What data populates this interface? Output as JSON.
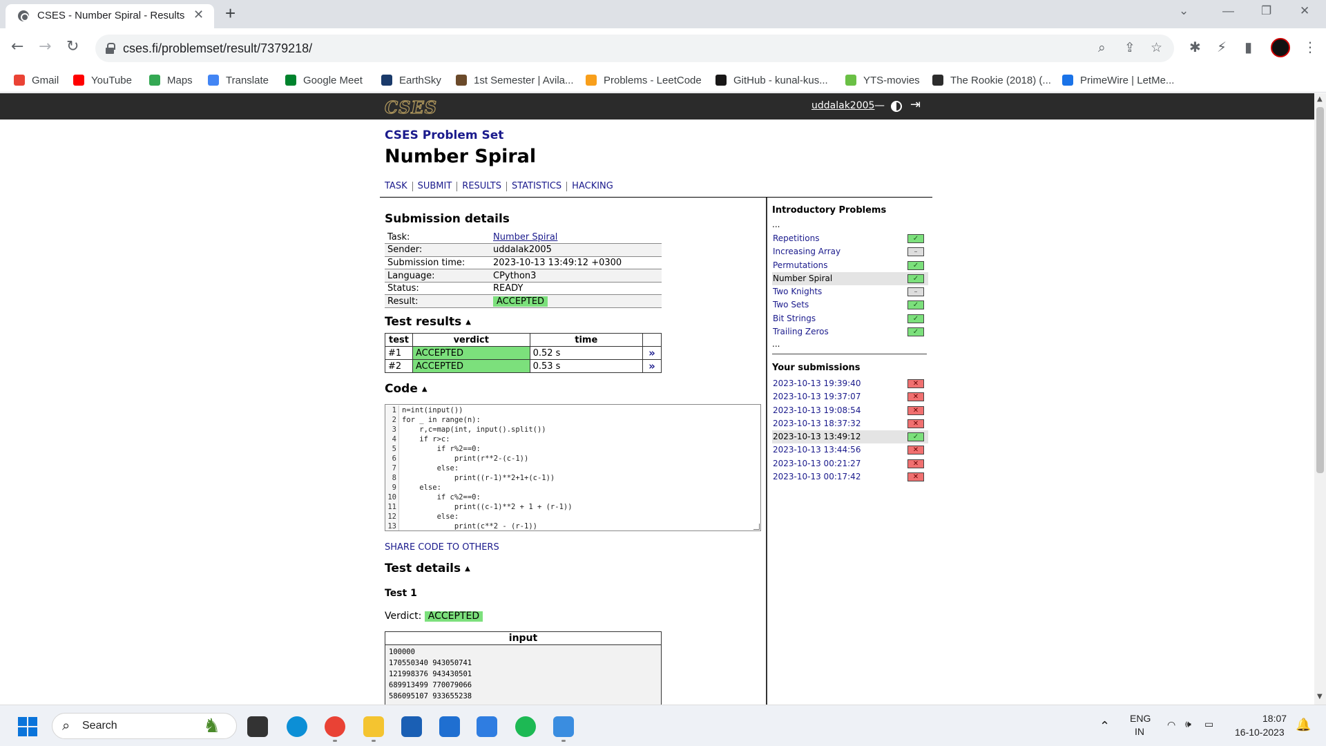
{
  "browser": {
    "tab_title": "CSES - Number Spiral - Results",
    "url": "cses.fi/problemset/result/7379218/",
    "bookmarks": [
      {
        "label": "Gmail",
        "color": "#ea4335"
      },
      {
        "label": "YouTube",
        "color": "#ff0000"
      },
      {
        "label": "Maps",
        "color": "#34a853"
      },
      {
        "label": "Translate",
        "color": "#4285f4"
      },
      {
        "label": "Google Meet",
        "color": "#00832d"
      },
      {
        "label": "EarthSky",
        "color": "#1a3a6a"
      },
      {
        "label": "1st Semester | Avila...",
        "color": "#6b4a2a"
      },
      {
        "label": "Problems - LeetCode",
        "color": "#f89f1b"
      },
      {
        "label": "GitHub - kunal-kus...",
        "color": "#181717"
      },
      {
        "label": "YTS-movies",
        "color": "#6ac045"
      },
      {
        "label": "The Rookie (2018) (...",
        "color": "#2c2c2c"
      },
      {
        "label": "PrimeWire | LetMe...",
        "color": "#1a73e8"
      }
    ]
  },
  "site": {
    "logo": "CSES",
    "username": "uddalak2005",
    "separator": "—"
  },
  "page": {
    "breadcrumb": "CSES Problem Set",
    "title": "Number Spiral",
    "tabs": [
      "TASK",
      "SUBMIT",
      "RESULTS",
      "STATISTICS",
      "HACKING"
    ]
  },
  "submission": {
    "heading": "Submission details",
    "rows": [
      {
        "label": "Task:",
        "value": "Number Spiral"
      },
      {
        "label": "Sender:",
        "value": "uddalak2005"
      },
      {
        "label": "Submission time:",
        "value": "2023-10-13 13:49:12 +0300"
      },
      {
        "label": "Language:",
        "value": "CPython3"
      },
      {
        "label": "Status:",
        "value": "READY"
      },
      {
        "label": "Result:",
        "value": "ACCEPTED"
      }
    ]
  },
  "test_results": {
    "heading": "Test results",
    "columns": [
      "test",
      "verdict",
      "time"
    ],
    "rows": [
      {
        "test": "#1",
        "verdict": "ACCEPTED",
        "time": "0.52 s"
      },
      {
        "test": "#2",
        "verdict": "ACCEPTED",
        "time": "0.53 s"
      }
    ]
  },
  "code": {
    "heading": "Code",
    "line_numbers": [
      "1",
      "2",
      "3",
      "4",
      "5",
      "6",
      "7",
      "8",
      "9",
      "10",
      "11",
      "12",
      "13"
    ],
    "lines": [
      "n=int(input())",
      "for _ in range(n):",
      "    r,c=map(int, input().split())",
      "    if r>c:",
      "        if r%2==0:",
      "            print(r**2-(c-1))",
      "        else:",
      "            print((r-1)**2+1+(c-1))",
      "    else:",
      "        if c%2==0:",
      "            print((c-1)**2 + 1 + (r-1))",
      "        else:",
      "            print(c**2 - (r-1))"
    ],
    "share_label": "SHARE CODE TO OTHERS"
  },
  "test_details": {
    "heading": "Test details",
    "test_label": "Test 1",
    "verdict_label": "Verdict:",
    "verdict": "ACCEPTED",
    "input_heading": "input",
    "input_lines": [
      "100000",
      "170550340 943050741",
      "121998376 943430501",
      "689913499 770079066",
      "586095107 933655238"
    ]
  },
  "sidebar": {
    "section_title": "Introductory Problems",
    "ellipsis": "...",
    "problems": [
      {
        "name": "Repetitions",
        "status": "ok",
        "current": false
      },
      {
        "name": "Increasing Array",
        "status": "none",
        "current": false
      },
      {
        "name": "Permutations",
        "status": "ok",
        "current": false
      },
      {
        "name": "Number Spiral",
        "status": "ok",
        "current": true
      },
      {
        "name": "Two Knights",
        "status": "none",
        "current": false
      },
      {
        "name": "Two Sets",
        "status": "ok",
        "current": false
      },
      {
        "name": "Bit Strings",
        "status": "ok",
        "current": false
      },
      {
        "name": "Trailing Zeros",
        "status": "ok",
        "current": false
      }
    ],
    "submissions_title": "Your submissions",
    "submissions": [
      {
        "time": "2023-10-13 19:39:40",
        "status": "bad",
        "current": false
      },
      {
        "time": "2023-10-13 19:37:07",
        "status": "bad",
        "current": false
      },
      {
        "time": "2023-10-13 19:08:54",
        "status": "bad",
        "current": false
      },
      {
        "time": "2023-10-13 18:37:32",
        "status": "bad",
        "current": false
      },
      {
        "time": "2023-10-13 13:49:12",
        "status": "ok",
        "current": true
      },
      {
        "time": "2023-10-13 13:44:56",
        "status": "bad",
        "current": false
      },
      {
        "time": "2023-10-13 00:21:27",
        "status": "bad",
        "current": false
      },
      {
        "time": "2023-10-13 00:17:42",
        "status": "bad",
        "current": false
      }
    ]
  },
  "taskbar": {
    "search_placeholder": "Search",
    "language": "ENG",
    "region": "IN",
    "time": "18:07",
    "date": "16-10-2023",
    "apps": [
      {
        "name": "file-explorer-dark",
        "color": "#333333"
      },
      {
        "name": "edge",
        "color": "#0c8fd6"
      },
      {
        "name": "chrome",
        "color": "#e94235"
      },
      {
        "name": "file-explorer",
        "color": "#f4c430"
      },
      {
        "name": "store",
        "color": "#1a5fb4"
      },
      {
        "name": "mail",
        "color": "#1f6fd1"
      },
      {
        "name": "todo",
        "color": "#2f7de1"
      },
      {
        "name": "spotify",
        "color": "#1db954"
      },
      {
        "name": "photos",
        "color": "#3a8de0"
      }
    ]
  }
}
